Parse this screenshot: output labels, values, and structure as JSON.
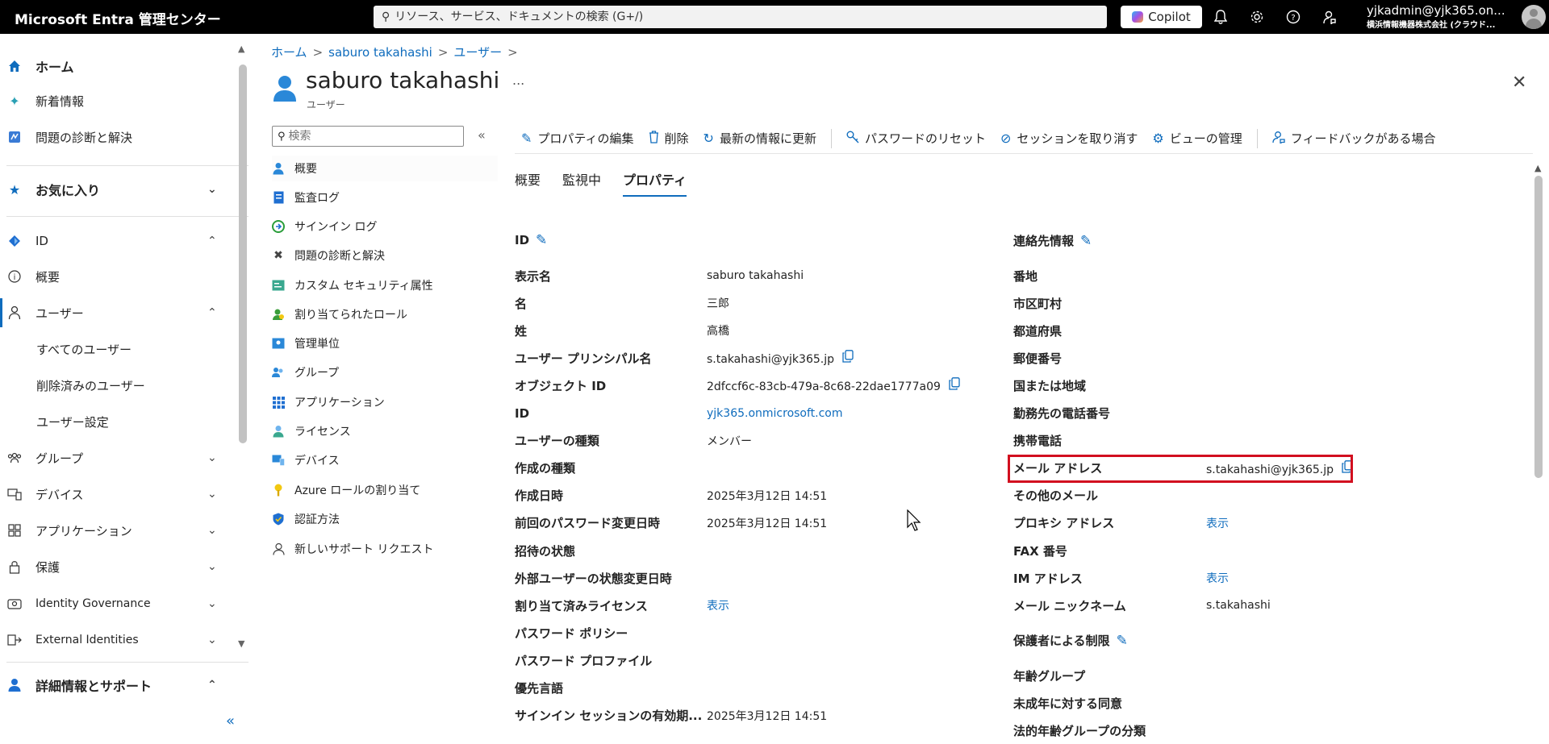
{
  "header": {
    "brand": "Microsoft Entra 管理センター",
    "search_placeholder": "リソース、サービス、ドキュメントの検索 (G+/)",
    "copilot_label": "Copilot",
    "account_email": "yjkadmin@yjk365.on...",
    "account_org": "横浜情報機器株式会社 (クラウド..."
  },
  "leftnav": {
    "home": "ホーム",
    "whats_new": "新着情報",
    "diagnose": "問題の診断と解決",
    "favorites": "お気に入り",
    "identity": "ID",
    "overview": "概要",
    "users": "ユーザー",
    "all_users": "すべてのユーザー",
    "deleted_users": "削除済みのユーザー",
    "user_settings": "ユーザー設定",
    "groups": "グループ",
    "devices": "デバイス",
    "applications": "アプリケーション",
    "protection": "保護",
    "identity_governance": "Identity Governance",
    "external_identities": "External Identities",
    "learn_support": "詳細情報とサポート"
  },
  "breadcrumb": {
    "home": "ホーム",
    "user": "saburo takahashi",
    "users": "ユーザー"
  },
  "page": {
    "title": "saburo takahashi",
    "subtitle": "ユーザー",
    "more": "..."
  },
  "resource_menu": {
    "search_placeholder": "検索",
    "items": [
      "概要",
      "監査ログ",
      "サインイン ログ",
      "問題の診断と解決",
      "カスタム セキュリティ属性",
      "割り当てられたロール",
      "管理単位",
      "グループ",
      "アプリケーション",
      "ライセンス",
      "デバイス",
      "Azure ロールの割り当て",
      "認証方法",
      "新しいサポート リクエスト"
    ]
  },
  "toolbar": {
    "edit": "プロパティの編集",
    "delete": "削除",
    "refresh": "最新の情報に更新",
    "reset_password": "パスワードのリセット",
    "revoke_sessions": "セッションを取り消す",
    "manage_view": "ビューの管理",
    "feedback": "フィードバックがある場合"
  },
  "tabs": [
    "概要",
    "監視中",
    "プロパティ"
  ],
  "identity_section": {
    "title": "ID",
    "rows": [
      {
        "label": "表示名",
        "value": "saburo takahashi"
      },
      {
        "label": "名",
        "value": "三郎"
      },
      {
        "label": "姓",
        "value": "高橋"
      },
      {
        "label": "ユーザー プリンシパル名",
        "value": "s.takahashi@yjk365.jp"
      },
      {
        "label": "オブジェクト ID",
        "value": "2dfccf6c-83cb-479a-8c68-22dae1777a09"
      },
      {
        "label": "ID",
        "value": "yjk365.onmicrosoft.com"
      },
      {
        "label": "ユーザーの種類",
        "value": "メンバー"
      },
      {
        "label": "作成の種類",
        "value": ""
      },
      {
        "label": "作成日時",
        "value": "2025年3月12日 14:51"
      },
      {
        "label": "前回のパスワード変更日時",
        "value": "2025年3月12日 14:51"
      },
      {
        "label": "招待の状態",
        "value": ""
      },
      {
        "label": "外部ユーザーの状態変更日時",
        "value": ""
      },
      {
        "label": "割り当て済みライセンス",
        "value": "表示"
      },
      {
        "label": "パスワード ポリシー",
        "value": ""
      },
      {
        "label": "パスワード プロファイル",
        "value": ""
      },
      {
        "label": "優先言語",
        "value": ""
      },
      {
        "label": "サインイン セッションの有効期...",
        "value": "2025年3月12日 14:51"
      }
    ]
  },
  "contact_section": {
    "title": "連絡先情報",
    "rows": [
      {
        "label": "番地",
        "value": ""
      },
      {
        "label": "市区町村",
        "value": ""
      },
      {
        "label": "都道府県",
        "value": ""
      },
      {
        "label": "郵便番号",
        "value": ""
      },
      {
        "label": "国または地域",
        "value": ""
      },
      {
        "label": "勤務先の電話番号",
        "value": ""
      },
      {
        "label": "携帯電話",
        "value": ""
      },
      {
        "label": "メール アドレス",
        "value": "s.takahashi@yjk365.jp"
      },
      {
        "label": "その他のメール",
        "value": ""
      },
      {
        "label": "プロキシ アドレス",
        "value": "表示"
      },
      {
        "label": "FAX 番号",
        "value": ""
      },
      {
        "label": "IM アドレス",
        "value": "表示"
      },
      {
        "label": "メール ニックネーム",
        "value": "s.takahashi"
      }
    ]
  },
  "guardian_section": {
    "title": "保護者による制限",
    "rows": [
      {
        "label": "年齢グループ",
        "value": ""
      },
      {
        "label": "未成年に対する同意",
        "value": ""
      },
      {
        "label": "法的年齢グループの分類",
        "value": ""
      }
    ]
  },
  "colors": {
    "accent": "#0f6cbd",
    "highlight": "#d20f1f",
    "topbar": "#000000"
  }
}
